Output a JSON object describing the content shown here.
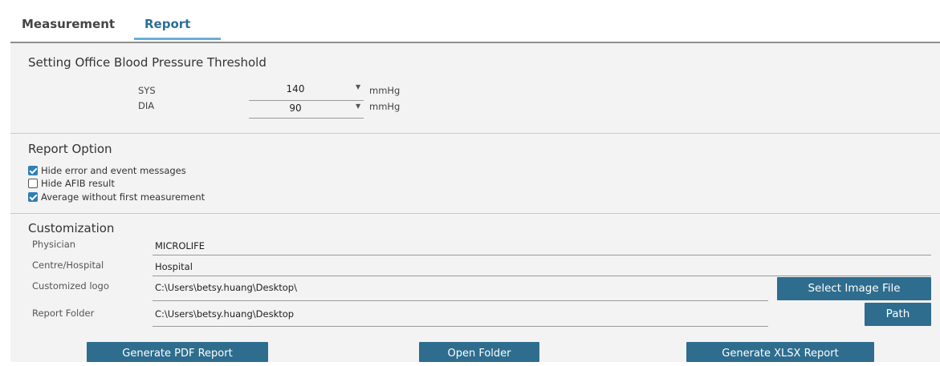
{
  "tabs": {
    "measurement": "Measurement",
    "report": "Report"
  },
  "threshold": {
    "title": "Setting Office Blood Pressure Threshold",
    "sys": {
      "label": "SYS",
      "value": "140",
      "unit": "mmHg"
    },
    "dia": {
      "label": "DIA",
      "value": "90",
      "unit": "mmHg"
    }
  },
  "report_option": {
    "title": "Report Option",
    "options": [
      {
        "label": "Hide error and event messages",
        "checked": true
      },
      {
        "label": "Hide AFIB result",
        "checked": false
      },
      {
        "label": "Average without first measurement",
        "checked": true
      }
    ]
  },
  "customization": {
    "title": "Customization",
    "physician": {
      "label": "Physician",
      "value": "MICROLIFE"
    },
    "centre": {
      "label": "Centre/Hospital",
      "value": "Hospital"
    },
    "logo": {
      "label": "Customized logo",
      "value": "C:\\Users\\betsy.huang\\Desktop\\",
      "button": "Select Image File"
    },
    "folder": {
      "label": "Report Folder",
      "value": "C:\\Users\\betsy.huang\\Desktop",
      "button": "Path"
    }
  },
  "actions": {
    "pdf": "Generate PDF Report",
    "open": "Open Folder",
    "xlsx": "Generate XLSX Report"
  },
  "colors": {
    "accent": "#2e6d8e",
    "tab_active": "#2b6f93",
    "checkbox": "#2f7fb7"
  }
}
